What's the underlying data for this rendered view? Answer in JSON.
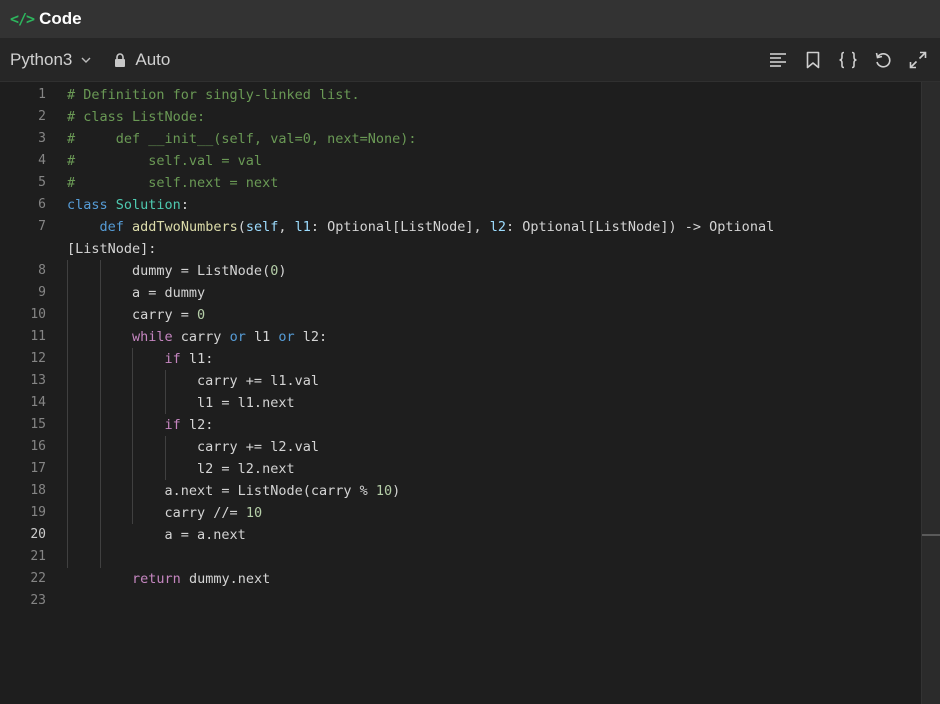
{
  "title": {
    "icon": "</>",
    "text": "Code"
  },
  "toolbar": {
    "language": "Python3",
    "mode": "Auto",
    "icons": [
      "format-icon",
      "bookmark-icon",
      "braces-icon",
      "reset-icon",
      "fullscreen-icon"
    ]
  },
  "colors": {
    "comment": "#6a9955",
    "keyword": "#569cd6",
    "control": "#c586c0",
    "function": "#dcdcaa",
    "class": "#4ec9b0",
    "param": "#9cdcfe",
    "number": "#b5cea8",
    "text": "#d4d4d4"
  },
  "editor": {
    "active_line": 20,
    "lines": [
      {
        "n": "1",
        "tokens": [
          [
            "# Definition for singly-linked list.",
            "comment"
          ]
        ]
      },
      {
        "n": "2",
        "tokens": [
          [
            "# class ListNode:",
            "comment"
          ]
        ]
      },
      {
        "n": "3",
        "tokens": [
          [
            "#     def __init__(self, val=0, next=None):",
            "comment"
          ]
        ]
      },
      {
        "n": "4",
        "tokens": [
          [
            "#         self.val = val",
            "comment"
          ]
        ]
      },
      {
        "n": "5",
        "tokens": [
          [
            "#         self.next = next",
            "comment"
          ]
        ]
      },
      {
        "n": "6",
        "tokens": [
          [
            "class",
            "keyword"
          ],
          [
            " ",
            "text"
          ],
          [
            "Solution",
            "class"
          ],
          [
            ":",
            "text"
          ]
        ]
      },
      {
        "n": "7",
        "tokens": [
          [
            "    ",
            "text"
          ],
          [
            "def",
            "keyword"
          ],
          [
            " ",
            "text"
          ],
          [
            "addTwoNumbers",
            "function"
          ],
          [
            "(",
            "text"
          ],
          [
            "self",
            "param"
          ],
          [
            ", ",
            "text"
          ],
          [
            "l1",
            "param"
          ],
          [
            ": Optional[ListNode], ",
            "text"
          ],
          [
            "l2",
            "param"
          ],
          [
            ": Optional[ListNode]) -> Optional",
            "text"
          ]
        ]
      },
      {
        "n": "",
        "tokens": [
          [
            "[ListNode]:",
            "text"
          ]
        ]
      },
      {
        "n": "8",
        "tokens": [
          [
            "        dummy = ListNode(",
            "text"
          ],
          [
            "0",
            "number"
          ],
          [
            ")",
            "text"
          ]
        ]
      },
      {
        "n": "9",
        "tokens": [
          [
            "        a = dummy",
            "text"
          ]
        ]
      },
      {
        "n": "10",
        "tokens": [
          [
            "        carry = ",
            "text"
          ],
          [
            "0",
            "number"
          ]
        ]
      },
      {
        "n": "11",
        "tokens": [
          [
            "        ",
            "text"
          ],
          [
            "while",
            "control"
          ],
          [
            " carry ",
            "text"
          ],
          [
            "or",
            "keyword"
          ],
          [
            " l1 ",
            "text"
          ],
          [
            "or",
            "keyword"
          ],
          [
            " l2:",
            "text"
          ]
        ]
      },
      {
        "n": "12",
        "tokens": [
          [
            "            ",
            "text"
          ],
          [
            "if",
            "control"
          ],
          [
            " l1:",
            "text"
          ]
        ]
      },
      {
        "n": "13",
        "tokens": [
          [
            "                carry += l1.val",
            "text"
          ]
        ]
      },
      {
        "n": "14",
        "tokens": [
          [
            "                l1 = l1.next",
            "text"
          ]
        ]
      },
      {
        "n": "15",
        "tokens": [
          [
            "            ",
            "text"
          ],
          [
            "if",
            "control"
          ],
          [
            " l2:",
            "text"
          ]
        ]
      },
      {
        "n": "16",
        "tokens": [
          [
            "                carry += l2.val",
            "text"
          ]
        ]
      },
      {
        "n": "17",
        "tokens": [
          [
            "                l2 = l2.next",
            "text"
          ]
        ]
      },
      {
        "n": "18",
        "tokens": [
          [
            "            a.next = ListNode(carry % ",
            "text"
          ],
          [
            "10",
            "number"
          ],
          [
            ")",
            "text"
          ]
        ]
      },
      {
        "n": "19",
        "tokens": [
          [
            "            carry //= ",
            "text"
          ],
          [
            "10",
            "number"
          ]
        ]
      },
      {
        "n": "20",
        "tokens": [
          [
            "            a = a.next",
            "text"
          ]
        ]
      },
      {
        "n": "21",
        "tokens": []
      },
      {
        "n": "22",
        "tokens": [
          [
            "        ",
            "text"
          ],
          [
            "return",
            "control"
          ],
          [
            " dummy.next",
            "text"
          ]
        ]
      },
      {
        "n": "23",
        "tokens": []
      }
    ]
  }
}
